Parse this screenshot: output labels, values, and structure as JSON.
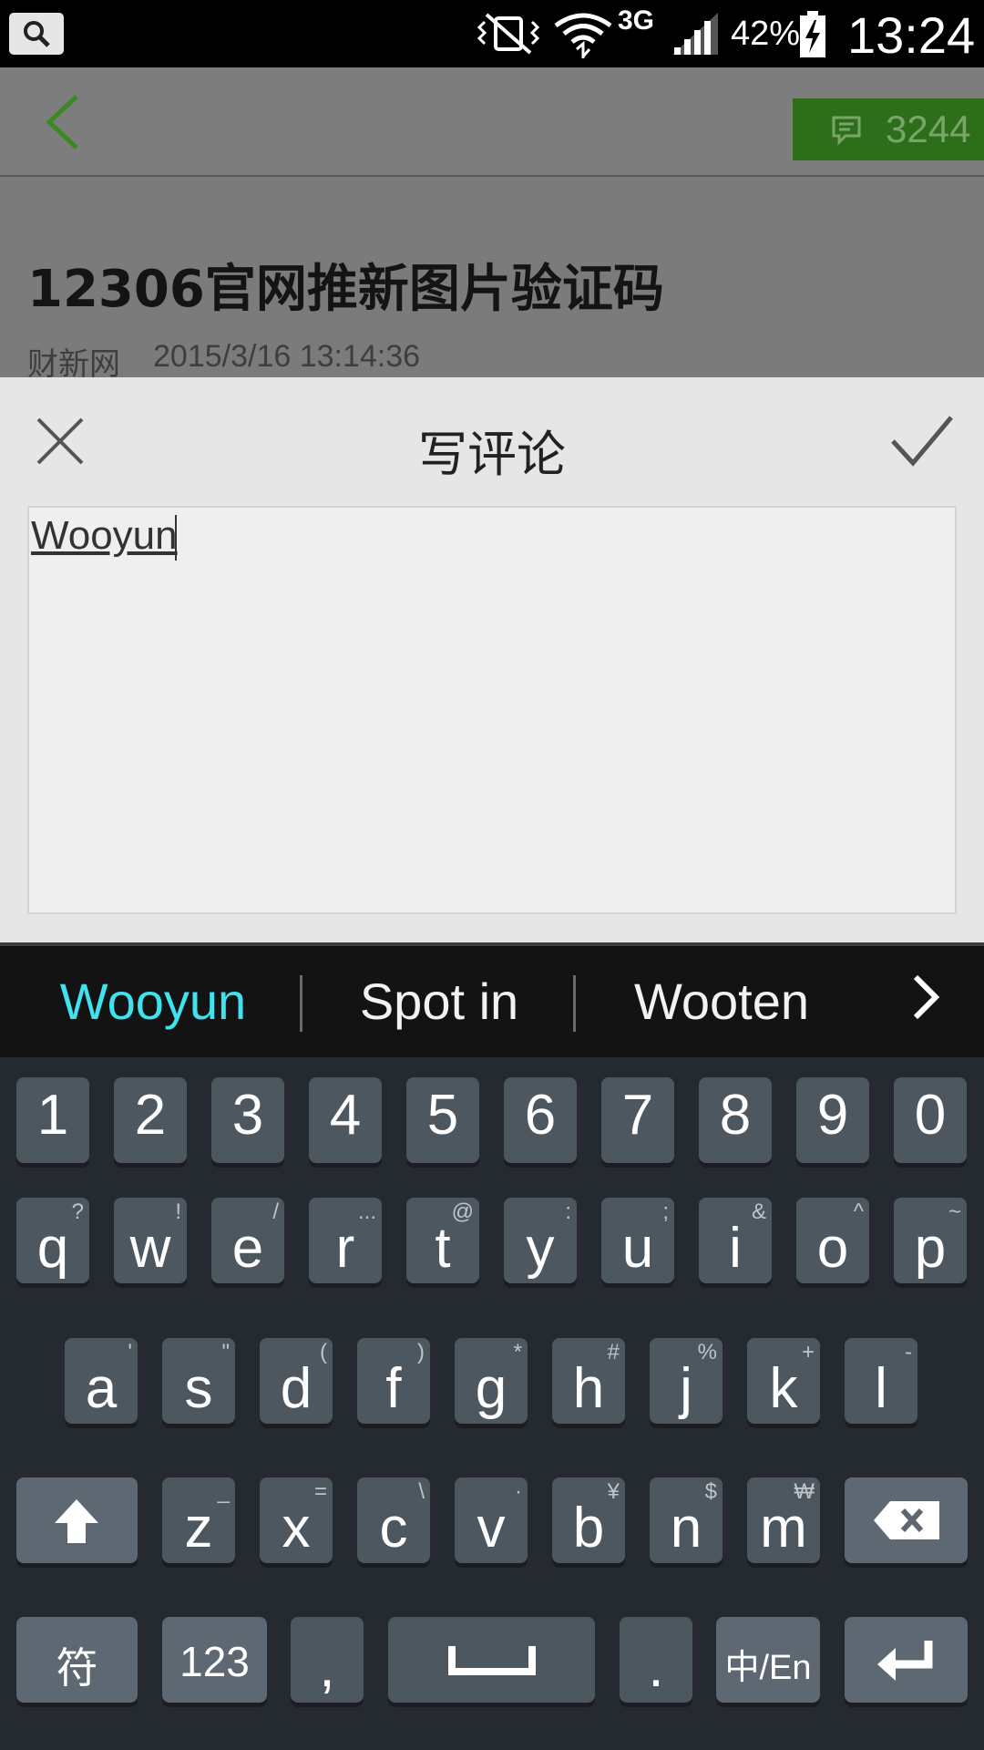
{
  "status_bar": {
    "network_type": "3G",
    "battery_percent": "42%",
    "time": "13:24"
  },
  "header": {
    "comment_count": "3244"
  },
  "article": {
    "title": "12306官网推新图片验证码",
    "source": "财新网",
    "published_time": "2015/3/16 13:14:36"
  },
  "comment_dialog": {
    "title": "写评论",
    "input_value": "Wooyun"
  },
  "keyboard": {
    "suggestions": [
      "Wooyun",
      "Spot in",
      "Wooten"
    ],
    "highlight_color": "#3fe3ef",
    "number_row": [
      "1",
      "2",
      "3",
      "4",
      "5",
      "6",
      "7",
      "8",
      "9",
      "0"
    ],
    "row1": [
      {
        "key": "q",
        "alt": "?"
      },
      {
        "key": "w",
        "alt": "!"
      },
      {
        "key": "e",
        "alt": "/"
      },
      {
        "key": "r",
        "alt": "..."
      },
      {
        "key": "t",
        "alt": "@"
      },
      {
        "key": "y",
        "alt": ":"
      },
      {
        "key": "u",
        "alt": ";"
      },
      {
        "key": "i",
        "alt": "&"
      },
      {
        "key": "o",
        "alt": "^"
      },
      {
        "key": "p",
        "alt": "~"
      }
    ],
    "row2": [
      {
        "key": "a",
        "alt": "'"
      },
      {
        "key": "s",
        "alt": "\""
      },
      {
        "key": "d",
        "alt": "("
      },
      {
        "key": "f",
        "alt": ")"
      },
      {
        "key": "g",
        "alt": "*"
      },
      {
        "key": "h",
        "alt": "#"
      },
      {
        "key": "j",
        "alt": "%"
      },
      {
        "key": "k",
        "alt": "+"
      },
      {
        "key": "l",
        "alt": "-"
      }
    ],
    "row3": [
      {
        "key": "z",
        "alt": "_"
      },
      {
        "key": "x",
        "alt": "="
      },
      {
        "key": "c",
        "alt": "\\"
      },
      {
        "key": "v",
        "alt": "·"
      },
      {
        "key": "b",
        "alt": "¥"
      },
      {
        "key": "n",
        "alt": "$"
      },
      {
        "key": "m",
        "alt": "₩"
      }
    ],
    "symbol_key": "符",
    "numbers_key": "123",
    "comma_key": ",",
    "period_key": ".",
    "lang_key": "中/En"
  }
}
